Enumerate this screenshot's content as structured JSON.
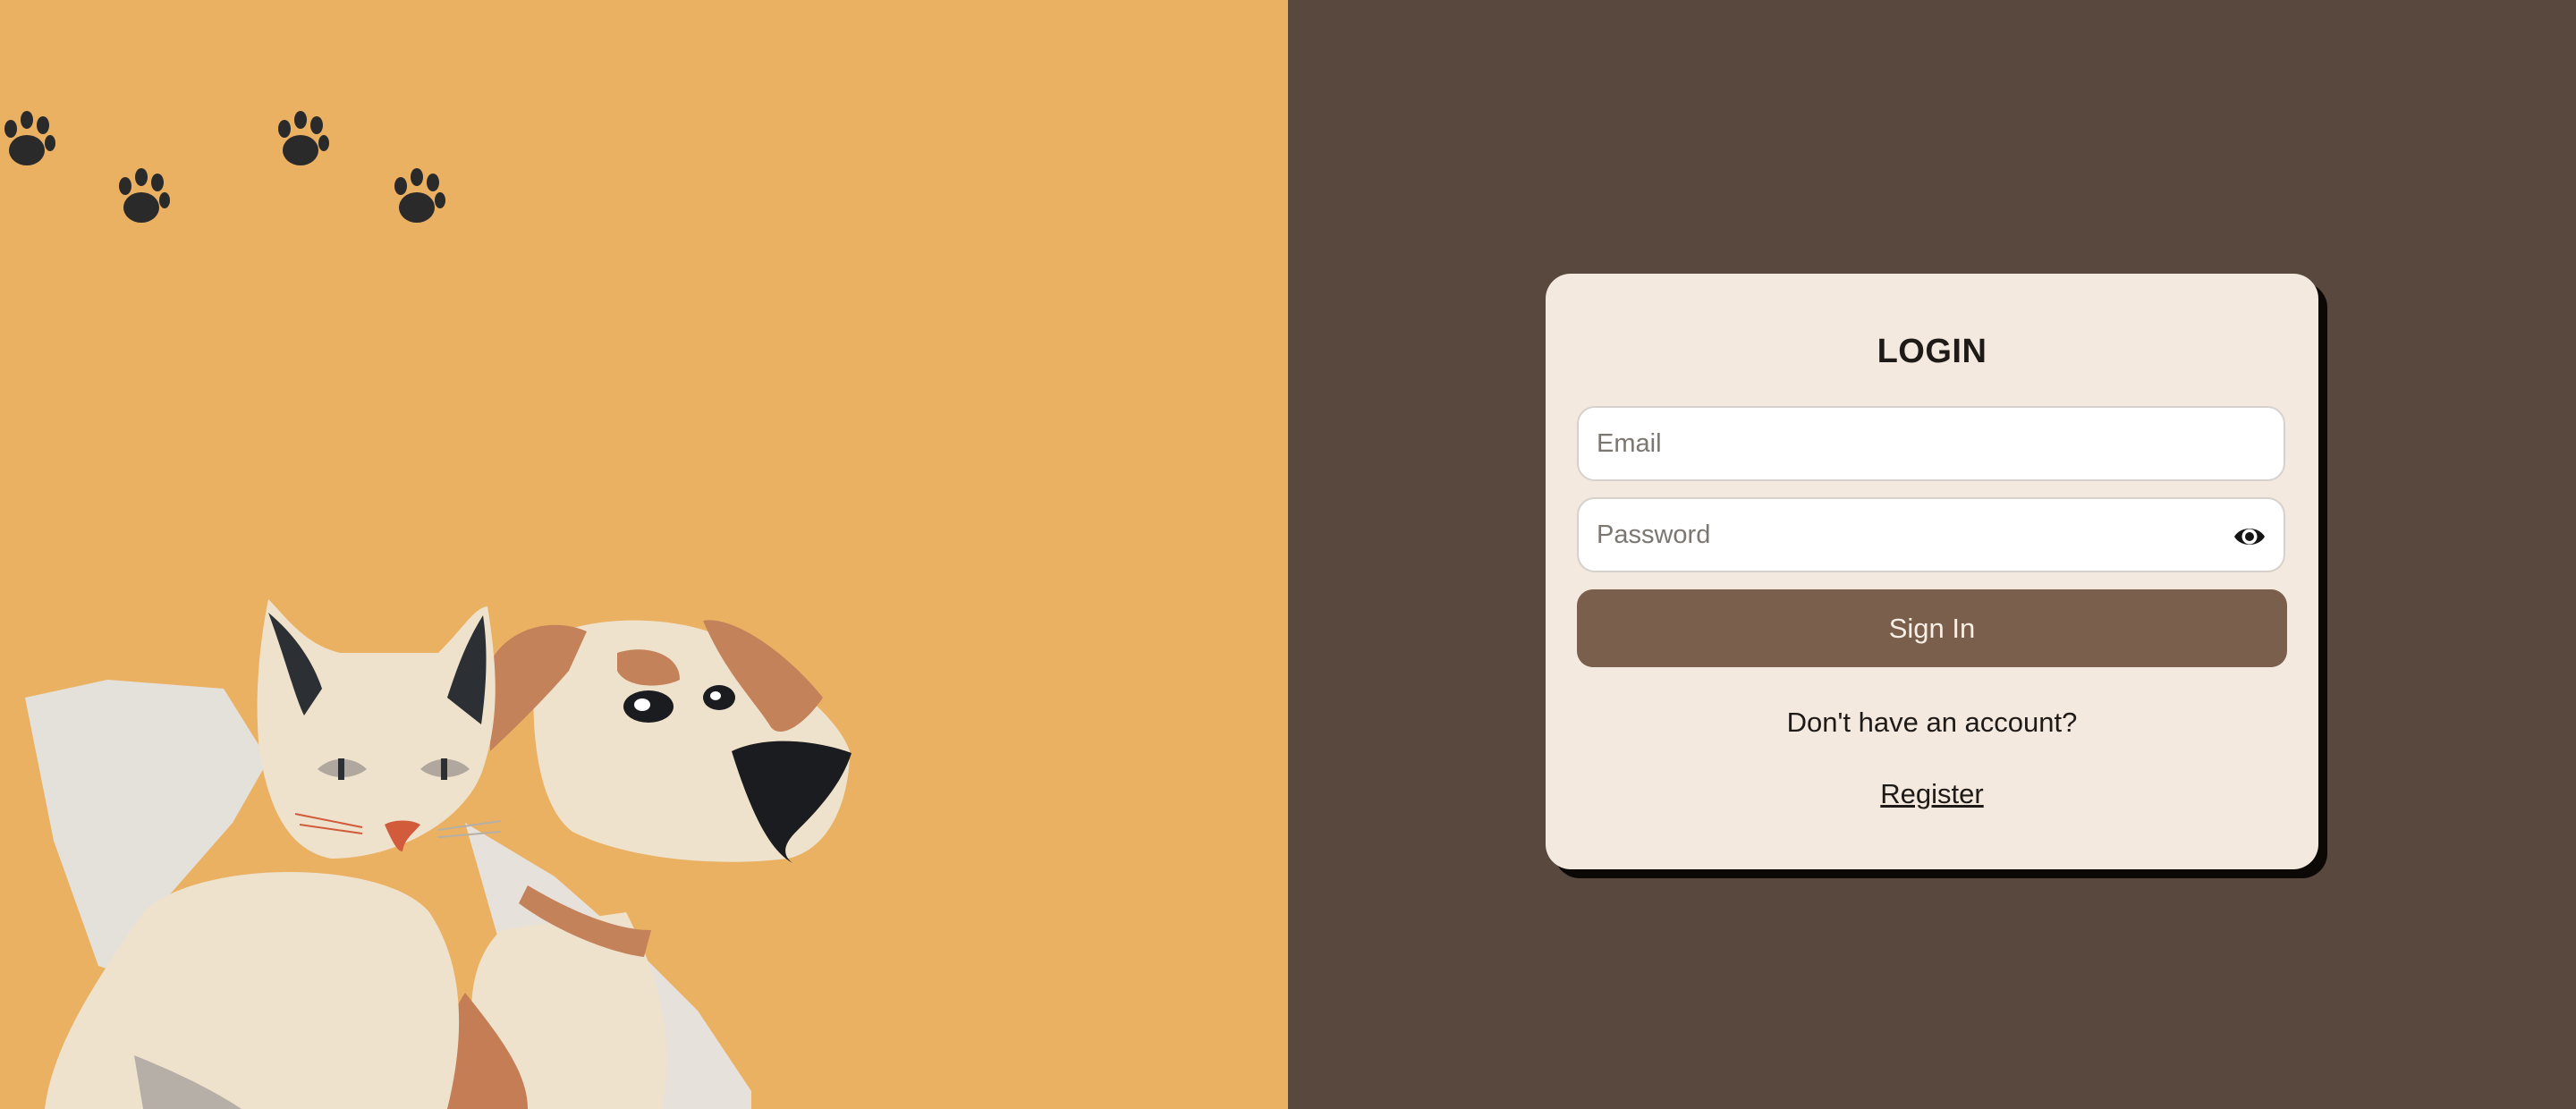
{
  "login": {
    "title": "LOGIN",
    "email_placeholder": "Email",
    "password_placeholder": "Password",
    "password_toggle_icon": "eye-icon",
    "sign_in_label": "Sign In",
    "no_account_text": "Don't have an account?",
    "register_label": "Register"
  },
  "colors": {
    "left_panel": "#EAB162",
    "right_panel": "#58483E",
    "card": "#F3E9DE",
    "button": "#7B5F4D",
    "paw": "#2A2A2A"
  },
  "illustration": {
    "icons": [
      "paw-print-icon",
      "cat-illustration",
      "dog-illustration"
    ]
  }
}
